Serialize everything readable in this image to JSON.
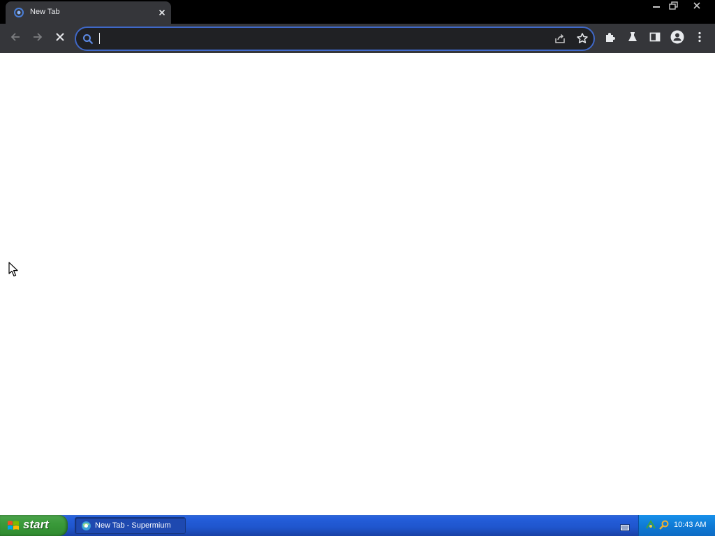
{
  "browser": {
    "tab": {
      "title": "New Tab"
    },
    "omnibox": {
      "value": "",
      "placeholder": ""
    }
  },
  "taskbar": {
    "start_label": "start",
    "task_button_label": "New Tab - Supermium",
    "clock": "10:43 AM"
  },
  "icons": {
    "tab_favicon": "supermium-logo-icon",
    "tab_close": "close-icon",
    "back": "arrow-left-icon",
    "forward": "arrow-right-icon",
    "stop": "close-icon",
    "omnibox_search": "search-icon",
    "share": "share-icon",
    "bookmark": "star-icon",
    "extensions": "puzzle-icon",
    "labs": "flask-icon",
    "side_panel": "side-panel-icon",
    "profile": "person-icon",
    "menu": "more-vert-icon"
  },
  "colors": {
    "tab_strip": "#000000",
    "toolbar": "#35363a",
    "omnibox_bg": "#202124",
    "omnibox_focus": "#3f68c8",
    "taskbar": "#245edb",
    "start_button": "#3a9a3a",
    "tray": "#0f7bd6"
  }
}
